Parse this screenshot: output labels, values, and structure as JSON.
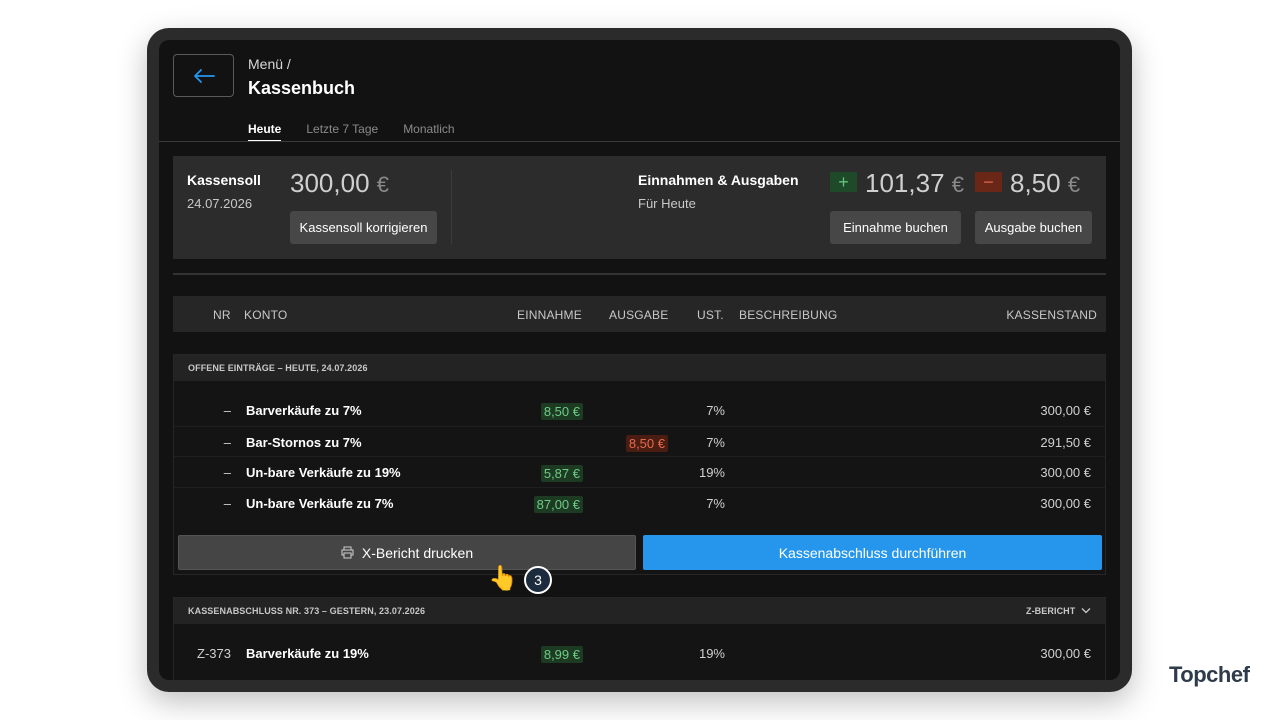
{
  "header": {
    "breadcrumb": "Menü /",
    "title": "Kassenbuch",
    "tabs": [
      {
        "label": "Heute",
        "active": true
      },
      {
        "label": "Letzte 7 Tage",
        "active": false
      },
      {
        "label": "Monatlich",
        "active": false
      }
    ]
  },
  "summary": {
    "kassensoll_label": "Kassensoll",
    "kassensoll_date": "24.07.2026",
    "kassensoll_amount": "300,00",
    "currency": "€",
    "kassensoll_button": "Kassensoll korrigieren",
    "ein_aus_label": "Einnahmen & Ausgaben",
    "ein_aus_sub": "Für Heute",
    "plus_sign": "+",
    "minus_sign": "−",
    "einnahmen_amount": "101,37",
    "ausgaben_amount": "8,50",
    "einnahme_button": "Einnahme buchen",
    "ausgabe_button": "Ausgabe buchen"
  },
  "table_header": {
    "nr": "NR",
    "konto": "KONTO",
    "einnahme": "EINNAHME",
    "ausgabe": "AUSGABE",
    "ust": "UST.",
    "beschreibung": "BESCHREIBUNG",
    "kassenstand": "KASSENSTAND"
  },
  "open_section": {
    "title": "OFFENE EINTRÄGE – HEUTE, 24.07.2026",
    "rows": [
      {
        "nr": "–",
        "konto": "Barverkäufe zu 7%",
        "einnahme": "8,50 €",
        "ausgabe": "",
        "ust": "7%",
        "kassenstand": "300,00 €"
      },
      {
        "nr": "–",
        "konto": "Bar-Stornos zu 7%",
        "einnahme": "",
        "ausgabe": "8,50 €",
        "ust": "7%",
        "kassenstand": "291,50 €"
      },
      {
        "nr": "–",
        "konto": "Un-bare Verkäufe zu 19%",
        "einnahme": "5,87 €",
        "ausgabe": "",
        "ust": "19%",
        "kassenstand": "300,00 €"
      },
      {
        "nr": "–",
        "konto": "Un-bare Verkäufe zu 7%",
        "einnahme": "87,00 €",
        "ausgabe": "",
        "ust": "7%",
        "kassenstand": "300,00 €"
      }
    ],
    "xbericht_button": "X-Bericht drucken",
    "abschluss_button": "Kassenabschluss durchführen"
  },
  "closed_section": {
    "title": "KASSENABSCHLUSS NR. 373 – GESTERN, 23.07.2026",
    "zbericht_label": "Z-BERICHT",
    "rows": [
      {
        "nr": "Z-373",
        "konto": "Barverkäufe zu 19%",
        "einnahme": "8,99 €",
        "ust": "19%",
        "kassenstand": "300,00 €"
      }
    ]
  },
  "step_badge": "3",
  "brand": "Topchef",
  "colors": {
    "accent": "#2596ec",
    "income": "#6fca85",
    "expense": "#e46a4e"
  },
  "icons": [
    "arrow-left-icon",
    "printer-icon",
    "chevron-down-icon",
    "pointing-hand-icon"
  ]
}
